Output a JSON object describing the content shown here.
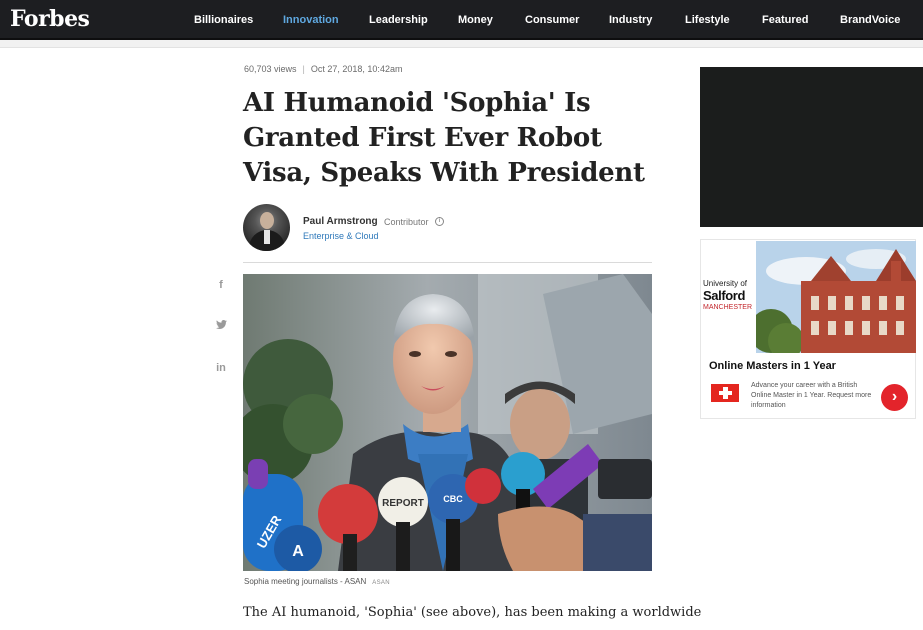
{
  "nav": {
    "logo": "Forbes",
    "items": [
      {
        "label": "Billionaires"
      },
      {
        "label": "Innovation",
        "active": true
      },
      {
        "label": "Leadership"
      },
      {
        "label": "Money"
      },
      {
        "label": "Consumer"
      },
      {
        "label": "Industry"
      },
      {
        "label": "Lifestyle"
      },
      {
        "label": "Featured"
      },
      {
        "label": "BrandVoice"
      }
    ]
  },
  "article": {
    "views": "60,703 views",
    "date": "Oct 27, 2018, 10:42am",
    "headline": "AI Humanoid 'Sophia' Is Granted First Ever Robot Visa, Speaks With President",
    "author": {
      "name": "Paul Armstrong",
      "role": "Contributor",
      "channel": "Enterprise & Cloud"
    },
    "share": [
      {
        "icon": "facebook-icon",
        "glyph": "f"
      },
      {
        "icon": "twitter-icon",
        "glyph": "🐦"
      },
      {
        "icon": "linkedin-icon",
        "glyph": "in"
      }
    ],
    "image": {
      "caption": "Sophia meeting journalists - ASAN",
      "credit": "ASAN",
      "mic_labels": [
        "REPORT",
        "CBC",
        "UZER",
        "A"
      ]
    },
    "body_first_line": "The AI humanoid, 'Sophia' (see above), has been making a worldwide"
  },
  "sidebar": {
    "ad": {
      "adchoices": "ⓘ✕",
      "university_line1": "University of",
      "university_name": "Salford",
      "university_city": "MANCHESTER",
      "title": "Online Masters in 1 Year",
      "text": "Advance your career with a British Online Master in 1 Year. Request more information",
      "cta_glyph": "›"
    }
  },
  "colors": {
    "nav_bg": "#1d1e21",
    "nav_active": "#5fa8e0",
    "link": "#2f79ba",
    "ad_red": "#e3242b"
  }
}
